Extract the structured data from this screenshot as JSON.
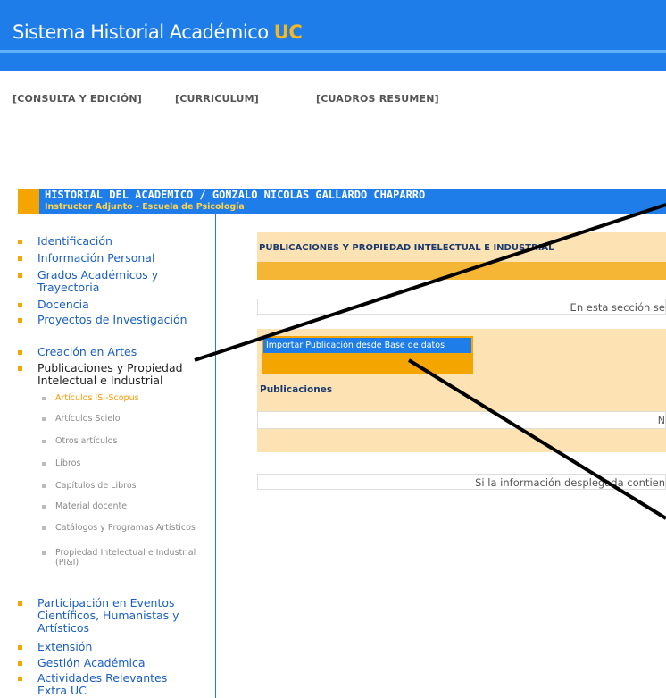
{
  "app": {
    "title_main": "Sistema Historial Académico",
    "title_uc": "UC"
  },
  "topnav": [
    "[CONSULTA Y EDICIÓN]",
    "[CURRICULUM]",
    "[CUADROS RESUMEN]"
  ],
  "header": {
    "name": "HISTORIAL DEL ACADÉMICO / GONZALO NICOLAS GALLARDO CHAPARRO",
    "role": "Instructor Adjunto - Escuela de Psicología"
  },
  "sidebar": {
    "items": [
      "Identificación",
      "Información Personal",
      "Grados Académicos y Trayectoria",
      "Docencia",
      "Proyectos de Investigación",
      "Creación en Artes",
      "Publicaciones y Propiedad Intelectual e Industrial",
      "Participación en Eventos Científicos, Humanistas y Artísticos",
      "Extensión",
      "Gestión Académica",
      "Actividades Relevantes Extra UC"
    ],
    "subitems": [
      "Artículos ISI-Scopus",
      "Artículos Scielo",
      "Otros artículos",
      "Libros",
      "Capítulos de Libros",
      "Material docente",
      "Catálogos y Programas Artísticos",
      "Propiedad Intelectual e Industrial (PI&I)"
    ]
  },
  "content": {
    "section_title": "PUBLICACIONES Y PROPIEDAD INTELECTUAL E INDUSTRIAL",
    "info_text": "En esta sección se",
    "import_button": "Importar Publicación desde Base de datos",
    "publications_label": "Publicaciones",
    "list_text": "N",
    "footer_info": "Si la información desplegada contien"
  },
  "colors": {
    "brand_blue": "#1e7de8",
    "accent_orange": "#f5a500",
    "light_orange": "#fde3b4"
  }
}
